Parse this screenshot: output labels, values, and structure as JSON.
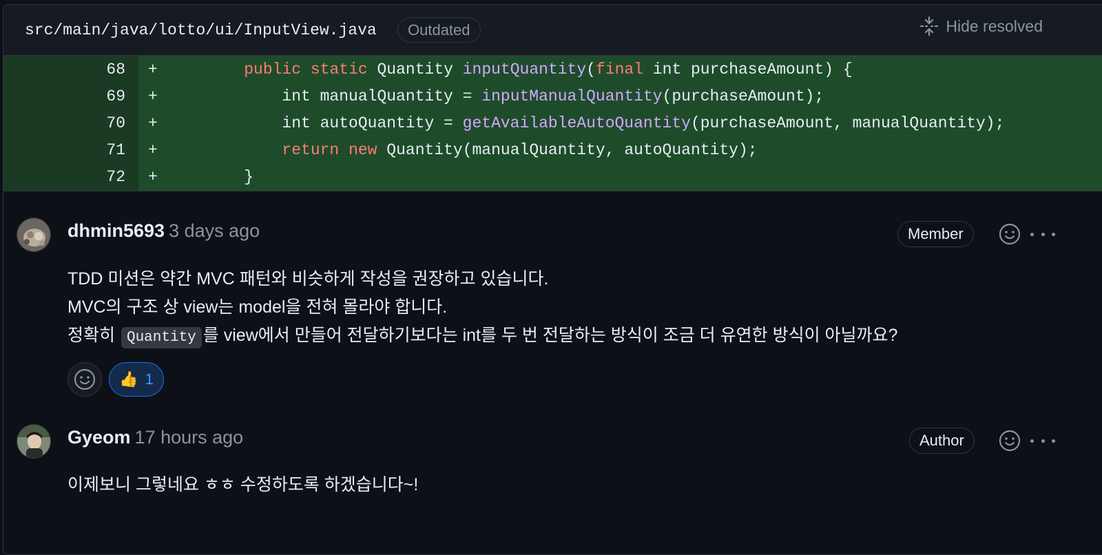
{
  "file_header": {
    "path": "src/main/java/lotto/ui/InputView.java",
    "badge": "Outdated",
    "hide_resolved_label": "Hide resolved",
    "hide_resolved_icon": "unfold-icon"
  },
  "diff": {
    "lines": [
      {
        "number": "68",
        "marker": "+",
        "indent": "    ",
        "tokens": [
          {
            "text": "public",
            "kind": "kw"
          },
          {
            "text": " ",
            "kind": "plain"
          },
          {
            "text": "static",
            "kind": "kw"
          },
          {
            "text": " Quantity ",
            "kind": "plain"
          },
          {
            "text": "inputQuantity",
            "kind": "fn"
          },
          {
            "text": "(",
            "kind": "plain"
          },
          {
            "text": "final",
            "kind": "kw"
          },
          {
            "text": " int purchaseAmount) {",
            "kind": "plain"
          }
        ]
      },
      {
        "number": "69",
        "marker": "+",
        "indent": "        ",
        "tokens": [
          {
            "text": "int manualQuantity = ",
            "kind": "plain"
          },
          {
            "text": "inputManualQuantity",
            "kind": "fn"
          },
          {
            "text": "(purchaseAmount);",
            "kind": "plain"
          }
        ]
      },
      {
        "number": "70",
        "marker": "+",
        "indent": "        ",
        "tokens": [
          {
            "text": "int autoQuantity = ",
            "kind": "plain"
          },
          {
            "text": "getAvailableAutoQuantity",
            "kind": "fn"
          },
          {
            "text": "(purchaseAmount, manualQuantity);",
            "kind": "plain"
          }
        ]
      },
      {
        "number": "71",
        "marker": "+",
        "indent": "        ",
        "tokens": [
          {
            "text": "return",
            "kind": "kw"
          },
          {
            "text": " ",
            "kind": "plain"
          },
          {
            "text": "new",
            "kind": "kw"
          },
          {
            "text": " Quantity(manualQuantity, autoQuantity);",
            "kind": "plain"
          }
        ]
      },
      {
        "number": "72",
        "marker": "+",
        "indent": "    ",
        "tokens": [
          {
            "text": "}",
            "kind": "plain"
          }
        ]
      }
    ]
  },
  "comments": [
    {
      "author": "dhmin5693",
      "timestamp": "3 days ago",
      "role": "Member",
      "lines": [
        "TDD 미션은 약간 MVC 패턴와 비슷하게 작성을 권장하고 있습니다.",
        "MVC의 구조 상 view는 model을 전혀 몰라야 합니다."
      ],
      "line3_before": "정확히",
      "line3_code": "Quantity",
      "line3_after": "를 view에서 만들어 전달하기보다는 int를 두 번 전달하는 방식이 조금 더 유연한 방식이 아닐까요?",
      "reaction": {
        "emoji": "👍",
        "icon": "thumbs-up-icon",
        "count": "1"
      }
    },
    {
      "author": "Gyeom",
      "timestamp": "17 hours ago",
      "role": "Author",
      "lines": [
        "이제보니 그렇네요 ㅎㅎ 수정하도록 하겠습니다~!"
      ]
    }
  ],
  "colors": {
    "background": "#0d1117",
    "diff_add_gutter": "#1b3a24",
    "diff_add_line": "#1e4c2b",
    "keyword": "#ff7b72",
    "function": "#d2a8ff",
    "reaction_accent": "#4493f8"
  }
}
